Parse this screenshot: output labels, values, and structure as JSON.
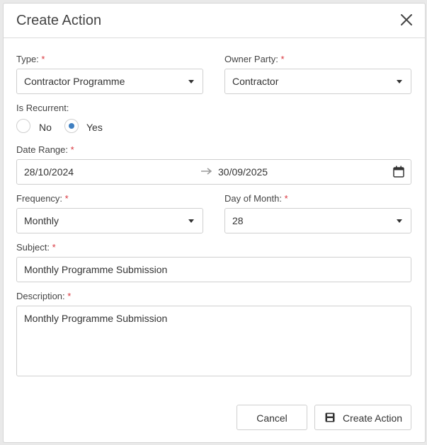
{
  "dialog": {
    "title": "Create Action"
  },
  "form": {
    "type": {
      "label": "Type:",
      "required": "*",
      "value": "Contractor Programme"
    },
    "owner_party": {
      "label": "Owner Party:",
      "required": "*",
      "value": "Contractor"
    },
    "is_recurrent": {
      "label": "Is Recurrent:",
      "options": [
        {
          "label": "No",
          "selected": false
        },
        {
          "label": "Yes",
          "selected": true
        }
      ]
    },
    "date_range": {
      "label": "Date Range:",
      "required": "*",
      "start": "28/10/2024",
      "end": "30/09/2025"
    },
    "frequency": {
      "label": "Frequency:",
      "required": "*",
      "value": "Monthly"
    },
    "day_of_month": {
      "label": "Day of Month:",
      "required": "*",
      "value": "28"
    },
    "subject": {
      "label": "Subject:",
      "required": "*",
      "value": "Monthly Programme Submission"
    },
    "description": {
      "label": "Description:",
      "required": "*",
      "value": "Monthly Programme Submission"
    }
  },
  "footer": {
    "cancel_label": "Cancel",
    "create_label": "Create Action"
  },
  "colors": {
    "required": "#d9363e",
    "radio_selected": "#3f7fc1",
    "border": "#cfcfcf"
  }
}
